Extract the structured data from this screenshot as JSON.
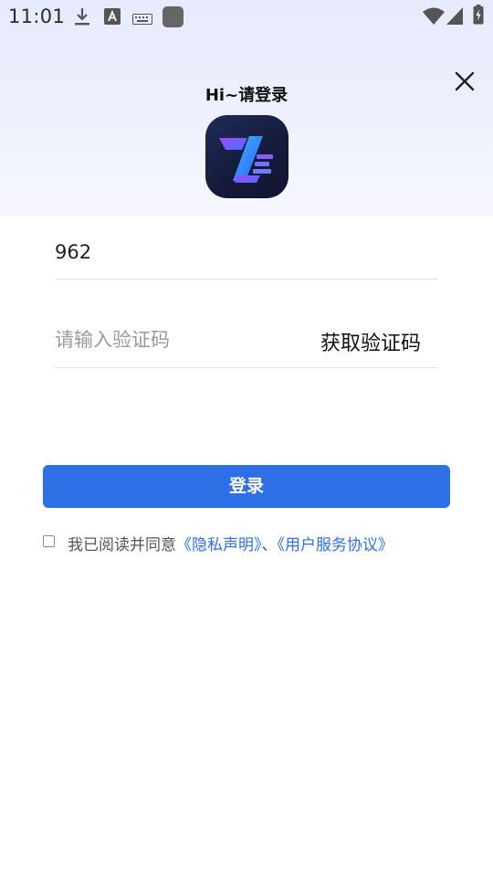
{
  "status_bar": {
    "time": "11:01",
    "left_icons": [
      "download-icon",
      "font-a-icon",
      "keyboard-icon",
      "app-square-icon"
    ],
    "right_icons": [
      "wifi-icon",
      "cellular-signal-icon",
      "battery-charging-icon"
    ]
  },
  "header": {
    "title": "Hi~请登录",
    "close_icon": "close-icon"
  },
  "form": {
    "phone_value": "962",
    "code_placeholder": "请输入验证码",
    "get_code_label": "获取验证码"
  },
  "login_button": {
    "label": "登录"
  },
  "agreement": {
    "prefix": "我已阅读并同意",
    "privacy_link": "《隐私声明》",
    "separator": "、",
    "terms_link": "《用户服务协议》"
  },
  "colors": {
    "accent": "#2f6fe6",
    "header_gradient_top": "#e6ebfd",
    "logo_background": "#141a38"
  }
}
